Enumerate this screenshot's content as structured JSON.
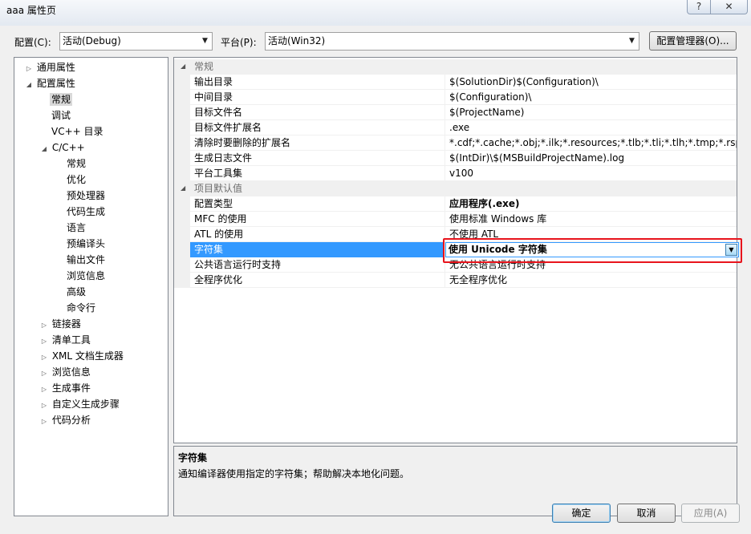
{
  "window": {
    "title": "aaa 属性页",
    "help_btn": "?",
    "close_btn": "✕"
  },
  "toolbar": {
    "config_label": "配置(C):",
    "config_value": "活动(Debug)",
    "platform_label": "平台(P):",
    "platform_value": "活动(Win32)",
    "config_manager_button": "配置管理器(O)..."
  },
  "tree": {
    "items": [
      {
        "label": "通用属性",
        "expander": "▷"
      },
      {
        "label": "配置属性",
        "expander": "◢"
      },
      {
        "label": "常规"
      },
      {
        "label": "调试"
      },
      {
        "label": "VC++ 目录"
      },
      {
        "label": "C/C++",
        "expander": "◢"
      },
      {
        "label": "常规"
      },
      {
        "label": "优化"
      },
      {
        "label": "预处理器"
      },
      {
        "label": "代码生成"
      },
      {
        "label": "语言"
      },
      {
        "label": "预编译头"
      },
      {
        "label": "输出文件"
      },
      {
        "label": "浏览信息"
      },
      {
        "label": "高级"
      },
      {
        "label": "命令行"
      },
      {
        "label": "链接器",
        "expander": "▷"
      },
      {
        "label": "清单工具",
        "expander": "▷"
      },
      {
        "label": "XML 文档生成器",
        "expander": "▷"
      },
      {
        "label": "浏览信息",
        "expander": "▷"
      },
      {
        "label": "生成事件",
        "expander": "▷"
      },
      {
        "label": "自定义生成步骤",
        "expander": "▷"
      },
      {
        "label": "代码分析",
        "expander": "▷"
      }
    ]
  },
  "grid": {
    "categories": [
      {
        "name": "常规",
        "expander": "◢"
      },
      {
        "name": "项目默认值",
        "expander": "◢"
      }
    ],
    "general_rows": [
      {
        "name": "输出目录",
        "value": "$(SolutionDir)$(Configuration)\\"
      },
      {
        "name": "中间目录",
        "value": "$(Configuration)\\"
      },
      {
        "name": "目标文件名",
        "value": "$(ProjectName)"
      },
      {
        "name": "目标文件扩展名",
        "value": ".exe"
      },
      {
        "name": "清除时要删除的扩展名",
        "value": "*.cdf;*.cache;*.obj;*.ilk;*.resources;*.tlb;*.tli;*.tlh;*.tmp;*.rsp;*.pgc"
      },
      {
        "name": "生成日志文件",
        "value": "$(IntDir)\\$(MSBuildProjectName).log"
      },
      {
        "name": "平台工具集",
        "value": "v100"
      }
    ],
    "default_rows": [
      {
        "name": "配置类型",
        "value": "应用程序(.exe)"
      },
      {
        "name": "MFC 的使用",
        "value": "使用标准 Windows 库"
      },
      {
        "name": "ATL 的使用",
        "value": "不使用 ATL"
      },
      {
        "name": "字符集",
        "value": "使用 Unicode 字符集"
      },
      {
        "name": "公共语言运行时支持",
        "value": "无公共语言运行时支持"
      },
      {
        "name": "全程序优化",
        "value": "无全程序优化"
      }
    ]
  },
  "description": {
    "title": "字符集",
    "text": "通知编译器使用指定的字符集；帮助解决本地化问题。"
  },
  "buttons": {
    "ok": "确定",
    "cancel": "取消",
    "apply": "应用(A)"
  },
  "icons": {
    "combo_arrow": "▼"
  }
}
